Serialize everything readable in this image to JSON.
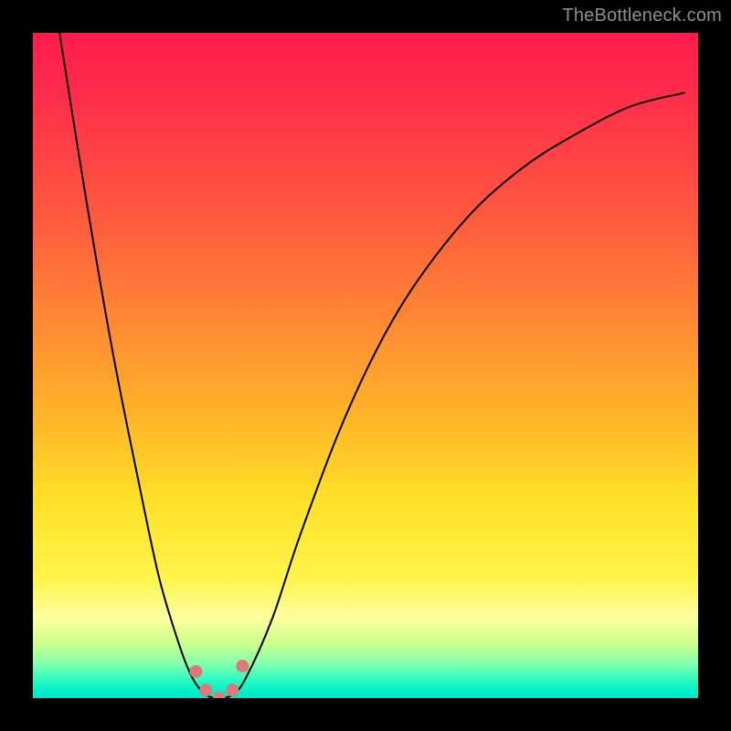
{
  "watermark": "TheBottleneck.com",
  "chart_data": {
    "type": "line",
    "title": "",
    "xlabel": "",
    "ylabel": "",
    "xlim": [
      0,
      100
    ],
    "ylim": [
      0,
      100
    ],
    "grid": false,
    "legend": false,
    "series": [
      {
        "name": "curve",
        "x": [
          4,
          8,
          12,
          16,
          19,
          22,
          24,
          26,
          28,
          30,
          32,
          36,
          40,
          46,
          52,
          58,
          66,
          74,
          82,
          90,
          98
        ],
        "y": [
          100,
          75,
          52,
          32,
          18,
          8,
          3,
          0.5,
          0,
          0.5,
          3,
          12,
          24,
          40,
          53,
          63,
          73,
          80,
          85,
          89,
          91
        ],
        "color": "#000000",
        "linewidth": 2
      }
    ],
    "markers": [
      {
        "x": 24.5,
        "y": 4.0,
        "r": 7,
        "color": "#e07878"
      },
      {
        "x": 26.0,
        "y": 1.2,
        "r": 7,
        "color": "#e07878"
      },
      {
        "x": 28.0,
        "y": 0.0,
        "r": 7,
        "color": "#e07878"
      },
      {
        "x": 30.0,
        "y": 1.2,
        "r": 7,
        "color": "#e07878"
      },
      {
        "x": 31.5,
        "y": 4.8,
        "r": 7,
        "color": "#e07878"
      }
    ],
    "background_gradient": {
      "top": "#ff1a4d",
      "mid": "#ffe028",
      "bottom": "#00e5cc"
    }
  }
}
